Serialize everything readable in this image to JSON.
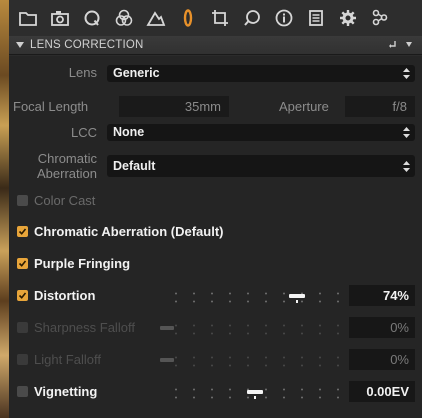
{
  "toolbar": {
    "tools": [
      {
        "icon": "folder-icon"
      },
      {
        "icon": "camera-icon"
      },
      {
        "icon": "search-icon"
      },
      {
        "icon": "color-circles-icon"
      },
      {
        "icon": "exposure-icon"
      },
      {
        "icon": "lens-icon",
        "active": true
      },
      {
        "icon": "crop-icon"
      },
      {
        "icon": "local-adjust-icon"
      },
      {
        "icon": "info-icon"
      },
      {
        "icon": "metadata-icon"
      },
      {
        "icon": "gear-icon"
      },
      {
        "icon": "batch-icon"
      }
    ],
    "accent_color": "#e8912a"
  },
  "section": {
    "title": "LENS CORRECTION"
  },
  "lens": {
    "label": "Lens",
    "value": "Generic"
  },
  "focal_length": {
    "label": "Focal Length",
    "value": "35mm"
  },
  "aperture": {
    "label": "Aperture",
    "value": "f/8"
  },
  "lcc": {
    "label": "LCC",
    "value": "None"
  },
  "chromatic": {
    "label_line1": "Chromatic",
    "label_line2": "Aberration",
    "value": "Default"
  },
  "checks": {
    "color_cast": {
      "label": "Color Cast",
      "checked": false
    },
    "chromatic_aberration": {
      "label": "Chromatic Aberration (Default)",
      "checked": true
    },
    "purple_fringing": {
      "label": "Purple Fringing",
      "checked": true
    }
  },
  "sliders": {
    "distortion": {
      "label": "Distortion",
      "checked": true,
      "value": "74%",
      "level": 0.74
    },
    "sharpness_falloff": {
      "label": "Sharpness Falloff",
      "checked": false,
      "value": "0%",
      "level": 0.0
    },
    "light_falloff": {
      "label": "Light Falloff",
      "checked": false,
      "value": "0%",
      "level": 0.0
    },
    "vignetting": {
      "label": "Vignetting",
      "checked": false,
      "value": "0.00EV",
      "level": 0.5
    }
  },
  "colors": {
    "checkbox_on": "#e8a53a",
    "panel_bg": "#252525"
  }
}
